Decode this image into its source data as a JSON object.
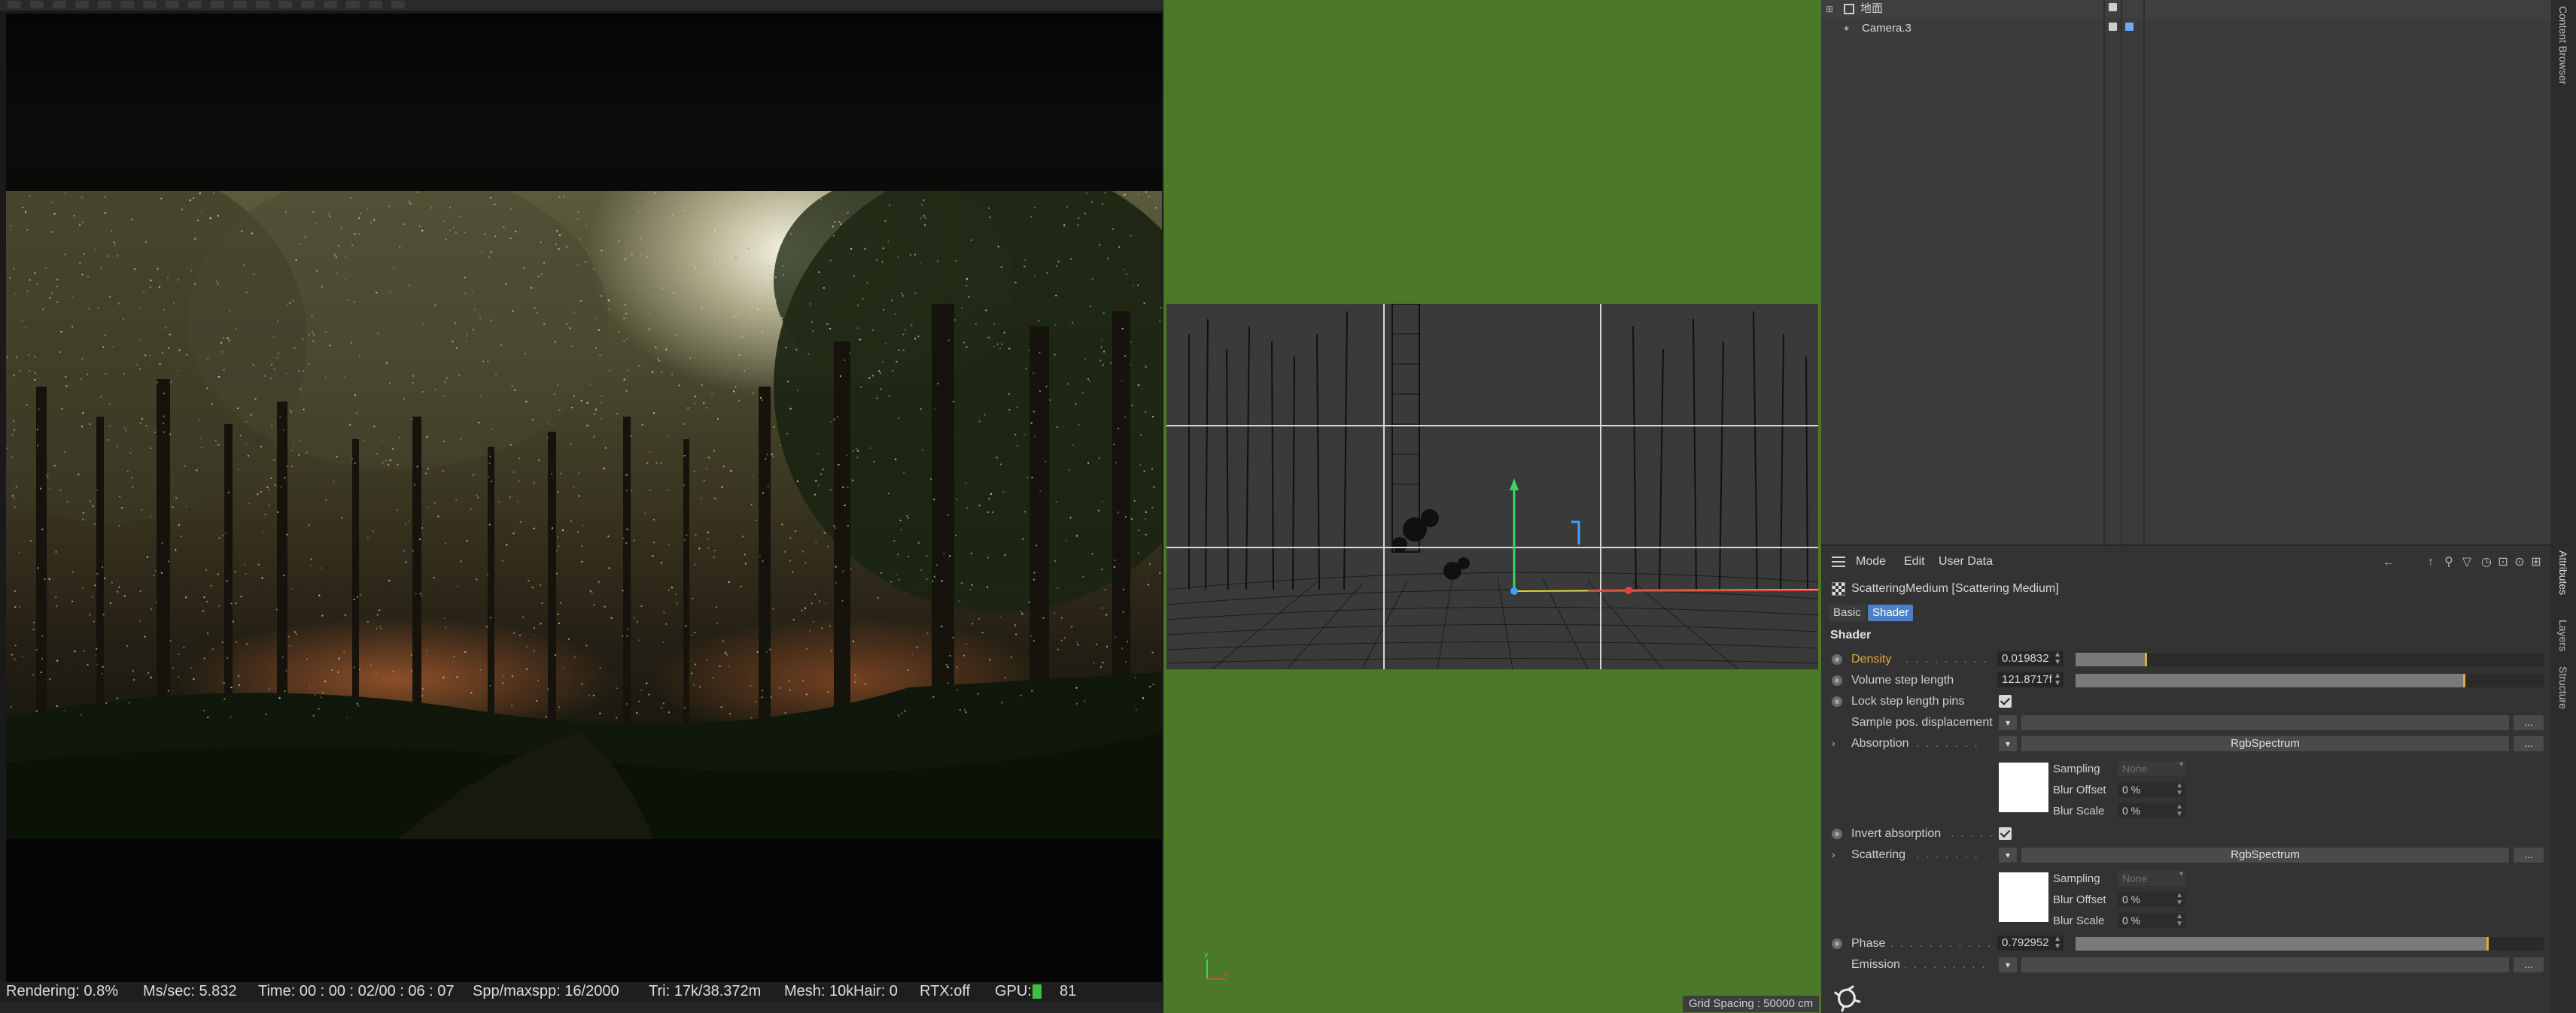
{
  "status_bar": {
    "rendering": "Rendering: 0.8%",
    "ms_sec": "Ms/sec: 5.832",
    "time": "Time: 00 : 00 : 02/00 : 06 : 07",
    "spp": "Spp/maxspp: 16/2000",
    "tri": "Tri: 17k/38.372m",
    "mesh": "Mesh: 10k",
    "hair": "Hair: 0",
    "rtx": "RTX:off",
    "gpu_label": "GPU:",
    "gpu_value": "81"
  },
  "viewport": {
    "grid_spacing": "Grid Spacing : 50000 cm",
    "axis_y": "y",
    "axis_x": "x"
  },
  "objects": {
    "items": [
      {
        "name": "地面"
      },
      {
        "name": "Camera.3"
      }
    ]
  },
  "side_tabs": {
    "top": "Content Browser",
    "attributes": "Attributes",
    "layers": "Layers",
    "structure": "Structure"
  },
  "attributes": {
    "menu": {
      "mode": "Mode",
      "edit": "Edit",
      "user_data": "User Data"
    },
    "title": "ScatteringMedium [Scattering Medium]",
    "tabs": {
      "basic": "Basic",
      "shader": "Shader"
    },
    "section": "Shader",
    "density": {
      "label": "Density",
      "value": "0.019832",
      "fraction": 0.15
    },
    "volume_step": {
      "label": "Volume step length",
      "value": "121.8717f",
      "fraction": 0.83
    },
    "lock_step": {
      "label": "Lock step length pins",
      "checked": true
    },
    "sample_pos": {
      "label": "Sample pos. displacement"
    },
    "absorption": {
      "label": "Absorption",
      "field": "RgbSpectrum",
      "sampling_label": "Sampling",
      "sampling_value": "None",
      "blur_offset_label": "Blur Offset",
      "blur_offset_value": "0 %",
      "blur_scale_label": "Blur Scale",
      "blur_scale_value": "0 %"
    },
    "invert_absorption": {
      "label": "Invert absorption",
      "checked": true
    },
    "scattering": {
      "label": "Scattering",
      "field": "RgbSpectrum",
      "sampling_label": "Sampling",
      "sampling_value": "None",
      "blur_offset_label": "Blur Offset",
      "blur_offset_value": "0 %",
      "blur_scale_label": "Blur Scale",
      "blur_scale_value": "0 %"
    },
    "phase": {
      "label": "Phase",
      "value": "0.792952",
      "fraction": 0.88
    },
    "emission": {
      "label": "Emission"
    },
    "more_label": "...",
    "highlight_color": "#e5a93b",
    "tab_active_color": "#4b82c4"
  }
}
